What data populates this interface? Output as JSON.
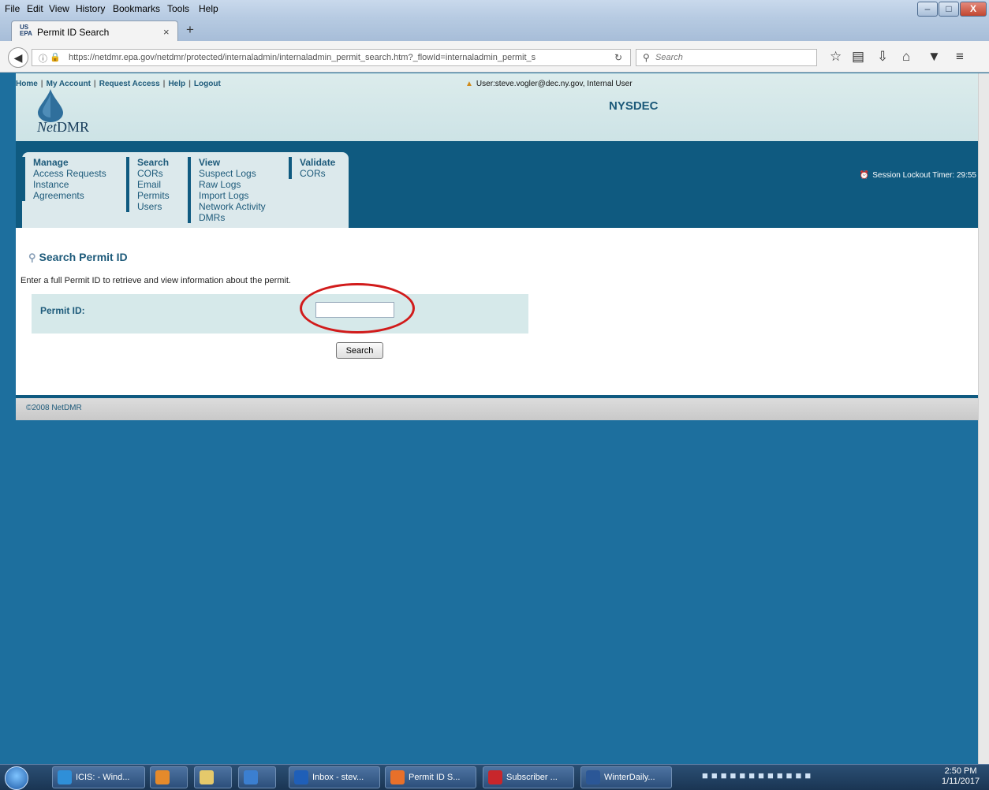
{
  "browser": {
    "menu": [
      "File",
      "Edit",
      "View",
      "History",
      "Bookmarks",
      "Tools",
      "Help"
    ],
    "window_buttons": {
      "minimize": "–",
      "maximize": "□",
      "close": "X"
    },
    "tab": {
      "favicon": "US EPA",
      "title": "Permit ID Search",
      "close": "×"
    },
    "new_tab": "+",
    "url": "https://netdmr.epa.gov/netdmr/protected/internaladmin/internaladmin_permit_search.htm?_flowId=internaladmin_permit_s",
    "search_placeholder": "Search",
    "icons": [
      "back-icon",
      "info-icon",
      "lock-icon",
      "reload-icon",
      "search-icon",
      "star-icon",
      "reading-list-icon",
      "download-icon",
      "home-icon",
      "pocket-icon",
      "menu-icon"
    ]
  },
  "header": {
    "links": [
      "Home",
      "My Account",
      "Request Access",
      "Help",
      "Logout"
    ],
    "logo_text_net": "Net",
    "logo_text_dmr": "DMR",
    "user": "User:steve.vogler@dec.ny.gov, Internal User",
    "org": "NYSDEC"
  },
  "nav": {
    "groups": [
      {
        "title": "Manage",
        "items": [
          "Access Requests",
          "Instance",
          "Agreements"
        ]
      },
      {
        "title": "Search",
        "items": [
          "CORs",
          "Email",
          "Permits",
          "Users"
        ]
      },
      {
        "title": "View",
        "items": [
          "Suspect Logs",
          "Raw Logs",
          "Import Logs",
          "Network Activity",
          "DMRs"
        ]
      },
      {
        "title": "Validate",
        "items": [
          "CORs"
        ]
      }
    ],
    "session_timer": "Session Lockout Timer: 29:55"
  },
  "content": {
    "title": "Search Permit ID",
    "intro": "Enter a full Permit ID to retrieve and view information about the permit.",
    "permit_label": "Permit ID:",
    "permit_value": "",
    "search_button": "Search"
  },
  "footer": {
    "copyright": "©2008 NetDMR"
  },
  "taskbar": {
    "items": [
      {
        "label": "ICIS: - Wind...",
        "color": "#2f8fd8"
      },
      {
        "label": "",
        "color": "#e58a2b"
      },
      {
        "label": "",
        "color": "#e5c96b"
      },
      {
        "label": "",
        "color": "#3b7fd0"
      },
      {
        "label": "Inbox - stev...",
        "color": "#1f5fb8"
      },
      {
        "label": "Permit ID S...",
        "color": "#e8702a"
      },
      {
        "label": "Subscriber ...",
        "color": "#c8262b"
      },
      {
        "label": "WinterDaily...",
        "color": "#2b5797"
      }
    ],
    "clock_time": "2:50 PM",
    "clock_date": "1/11/2017"
  }
}
